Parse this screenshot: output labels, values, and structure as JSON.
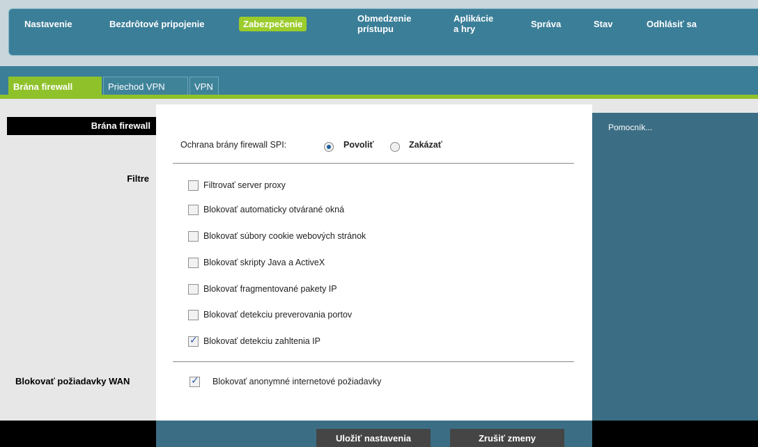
{
  "nav": {
    "items": [
      {
        "label": "Nastavenie"
      },
      {
        "label": "Bezdrôtové pripojenie"
      },
      {
        "label": "Zabezpečenie"
      },
      {
        "label": "Obmedzenie prístupu"
      },
      {
        "label": "Aplikácie a hry"
      },
      {
        "label": "Správa"
      },
      {
        "label": "Stav"
      },
      {
        "label": "Odhlásiť sa"
      }
    ],
    "active": "Zabezpečenie"
  },
  "tabs": [
    {
      "label": "Brána firewall"
    },
    {
      "label": "Priechod VPN"
    },
    {
      "label": "VPN"
    }
  ],
  "left": {
    "header": "Brána firewall",
    "filters_label": "Filtre",
    "wan_label": "Blokovať požiadavky WAN"
  },
  "spi": {
    "label": "Ochrana brány firewall SPI:",
    "options": [
      "Povoliť",
      "Zakázať"
    ],
    "selected": "Povoliť"
  },
  "filters": [
    {
      "label": "Filtrovať server proxy",
      "checked": false
    },
    {
      "label": "Blokovať automaticky otvárané okná",
      "checked": false
    },
    {
      "label": "Blokovať súbory cookie webových stránok",
      "checked": false
    },
    {
      "label": "Blokovať skripty Java a ActiveX",
      "checked": false
    },
    {
      "label": "Blokovať fragmentované pakety IP",
      "checked": false
    },
    {
      "label": "Blokovať detekciu preverovania portov",
      "checked": false
    },
    {
      "label": "Blokovať detekciu zahltenia IP",
      "checked": true
    }
  ],
  "wan": {
    "label": "Blokovať anonymné internetové požiadavky",
    "checked": true
  },
  "help": {
    "label": "Pomocník..."
  },
  "buttons": {
    "save": "Uložiť nastavenia",
    "cancel": "Zrušiť zmeny"
  }
}
